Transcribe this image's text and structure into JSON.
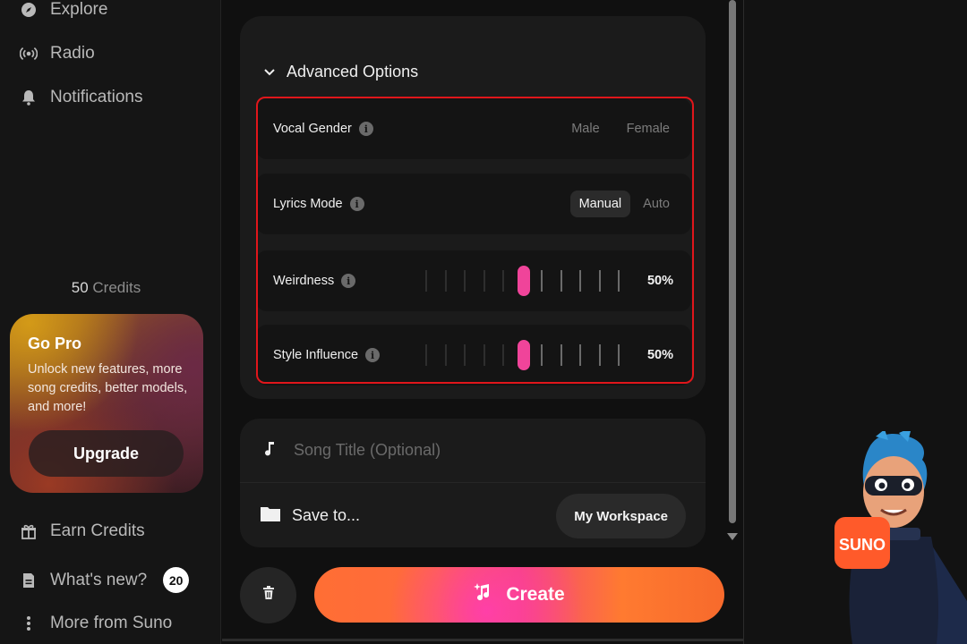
{
  "sidebar": {
    "nav_top": [
      {
        "label": "Explore",
        "icon": "compass-icon"
      },
      {
        "label": "Radio",
        "icon": "radio-icon"
      },
      {
        "label": "Notifications",
        "icon": "bell-icon"
      }
    ],
    "credits_count": "50",
    "credits_label": "Credits",
    "gopro": {
      "title": "Go Pro",
      "description": "Unlock new features, more song credits, better models, and more!",
      "button": "Upgrade"
    },
    "nav_bottom": [
      {
        "label": "Earn Credits",
        "icon": "gift-icon"
      },
      {
        "label": "What's new?",
        "icon": "document-icon",
        "badge": "20"
      },
      {
        "label": "More from Suno",
        "icon": "more-vertical-icon"
      }
    ]
  },
  "advanced": {
    "header": "Advanced Options",
    "vocal_gender": {
      "label": "Vocal Gender",
      "options": [
        "Male",
        "Female"
      ]
    },
    "lyrics_mode": {
      "label": "Lyrics Mode",
      "options": [
        "Manual",
        "Auto"
      ],
      "selected": "Manual"
    },
    "weirdness": {
      "label": "Weirdness",
      "value_text": "50%",
      "value": 0.5
    },
    "style_influence": {
      "label": "Style Influence",
      "value_text": "50%",
      "value": 0.5
    }
  },
  "song_title": {
    "placeholder": "Song Title (Optional)"
  },
  "save_to": {
    "label": "Save to...",
    "workspace": "My Workspace"
  },
  "create_button": "Create",
  "mascot_text": "SUNO",
  "colors": {
    "accent_pink": "#f0449a",
    "highlight_red": "#e0161b",
    "create_orange": "#ff6e34"
  }
}
